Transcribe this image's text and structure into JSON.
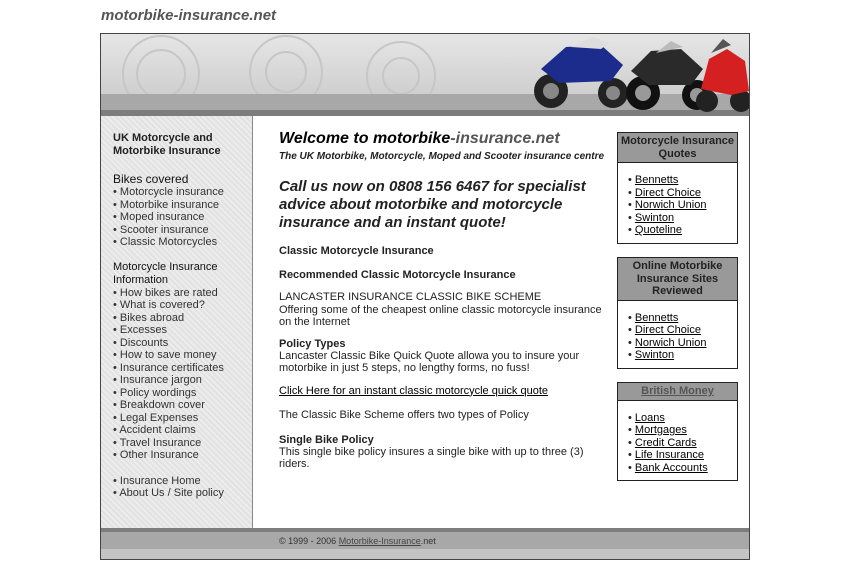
{
  "site": {
    "title": "motorbike-insurance.net"
  },
  "sidebar": {
    "heading": "UK Motorcycle and Motorbike Insurance",
    "bikes_title": "Bikes covered",
    "bikes": [
      "Motorcycle insurance",
      "Motorbike insurance",
      "Moped insurance",
      "Scooter insurance",
      "Classic Motorcycles"
    ],
    "info_title": "Motorcycle Insurance Information",
    "info": [
      "How bikes are rated",
      "What is covered?",
      "Bikes abroad",
      "Excesses",
      "Discounts",
      "How to save money",
      "Insurance certificates",
      "Insurance jargon",
      "Policy wordings",
      "Breakdown cover",
      "Legal Expenses",
      "Accident claims",
      "Travel Insurance",
      "Other Insurance"
    ],
    "footer_links": [
      "Insurance Home",
      "About Us / Site policy"
    ]
  },
  "main": {
    "welcome_prefix": "Welcome to motorbike",
    "welcome_suffix": "-insurance.net",
    "subtitle": "The UK Motorbike, Motorcycle, Moped and Scooter insurance centre",
    "call": "Call us now on 0808 156 6467 for specialist advice about motorbike and motorcycle insurance and an instant quote!",
    "h1": "Classic Motorcycle Insurance",
    "h2": "Recommended Classic Motorcycle Insurance",
    "scheme_title": "LANCASTER INSURANCE CLASSIC BIKE SCHEME",
    "scheme_text": "Offering some of the cheapest online classic motorcycle insurance on the Internet",
    "policy_types_title": "Policy Types",
    "policy_types_text": "Lancaster Classic Bike Quick Quote allowa you to insure your motorbike in just 5 steps, no lengthy forms, no fuss!",
    "quote_link": "Click Here for an instant classic motorcycle quick quote",
    "two_types": "The Classic Bike Scheme offers two types of Policy",
    "single_title": "Single Bike Policy",
    "single_text": "This single bike policy insures a single bike with up to three (3) riders."
  },
  "boxes": {
    "quotes": {
      "title": "Motorcycle Insurance Quotes",
      "links": [
        "Bennetts",
        "Direct Choice ",
        "Norwich Union",
        "Swinton",
        "Quoteline"
      ]
    },
    "reviewed": {
      "title": "Online Motorbike Insurance Sites Reviewed",
      "links": [
        "Bennetts",
        "Direct Choice",
        "Norwich Union",
        "Swinton"
      ]
    },
    "money": {
      "title": "British Money",
      "links": [
        "Loans",
        "Mortgages",
        "Credit Cards",
        "Life Insurance",
        "Bank Accounts"
      ]
    }
  },
  "footer": {
    "copyright": "© 1999 - 2006 ",
    "link": "Motorbike-Insurance",
    "suffix": ".net"
  },
  "colors": {
    "stripe": "#a8a8a8",
    "box_header": "#999999",
    "bike_blue": "#1c2c8c",
    "bike_red": "#d42020"
  }
}
